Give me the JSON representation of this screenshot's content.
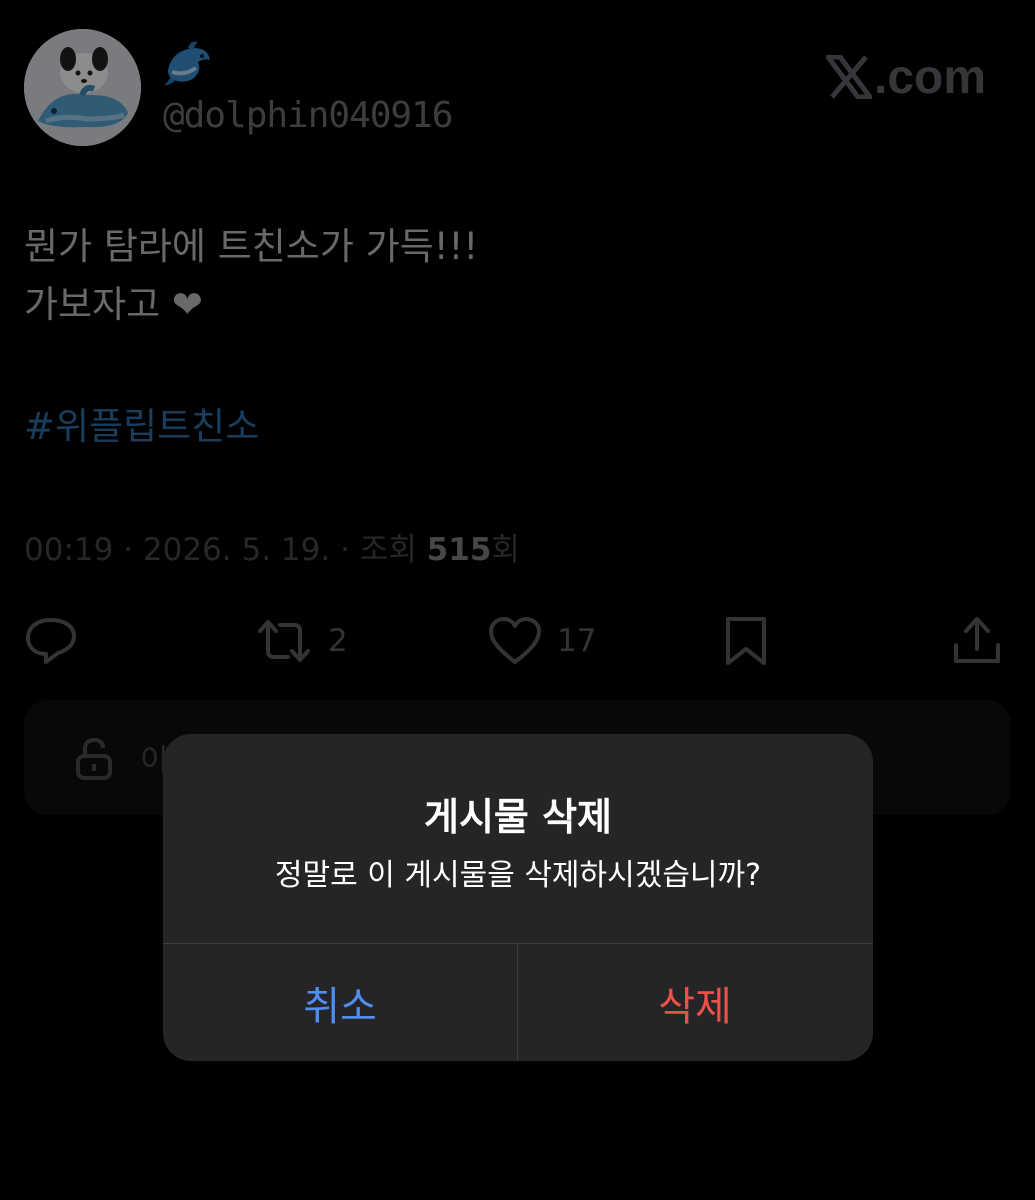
{
  "header": {
    "avatar_icon": "dog-with-dolphin-avatar",
    "display_name_icon": "dolphin-emoji",
    "handle": "@dolphin040916",
    "brand": ".com",
    "brand_icon": "x-logo-icon"
  },
  "tweet": {
    "lines": [
      "뭔가 탐라에 트친소가 가득!!!",
      "가보자고 ❤"
    ],
    "hashtag": "#위플립트친소",
    "meta_prefix": "00:19 · 2026. 5. 19. · 조회 ",
    "views": "515",
    "meta_suffix": "회"
  },
  "actions": {
    "reply_icon": "reply-icon",
    "retweet_count": "2",
    "like_count": "17",
    "bookmark_icon": "bookmark-icon",
    "share_icon": "share-icon"
  },
  "panel": {
    "text": "이",
    "icon": "unlock-icon"
  },
  "dialog": {
    "title": "게시물 삭제",
    "message": "정말로 이 게시물을 삭제하시겠습니까?",
    "cancel_label": "취소",
    "delete_label": "삭제",
    "colors": {
      "cancel": "#4f8df0",
      "delete": "#ec5149",
      "background": "#252527"
    }
  }
}
